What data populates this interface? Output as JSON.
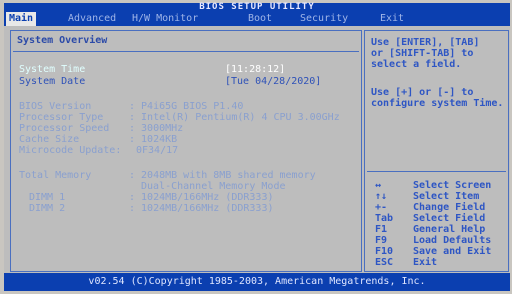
{
  "title": "BIOS SETUP UTILITY",
  "tabs": [
    "Main",
    "Advanced",
    "H/W Monitor",
    "Boot",
    "Security",
    "Exit"
  ],
  "overview": {
    "heading": "System Overview",
    "system_time_label": "System Time",
    "system_time_value": "[11:28:12]",
    "system_date_label": "System Date",
    "system_date_value": "[Tue 04/28/2020]",
    "bios_version_label": "BIOS Version",
    "bios_version_value": ": P4i65G BIOS P1.40",
    "processor_type_label": "Processor Type",
    "processor_type_value": ": Intel(R) Pentium(R) 4 CPU 3.00GHz",
    "processor_speed_label": "Processor Speed",
    "processor_speed_value": ": 3000MHz",
    "cache_size_label": "Cache Size",
    "cache_size_value": ": 1024KB",
    "microcode_label": "Microcode Update:",
    "microcode_value": "0F34/17",
    "total_memory_label": "Total Memory",
    "total_memory_value": ": 2048MB with 8MB shared memory",
    "memory_mode": "Dual-Channel Memory Mode",
    "dimm1_label": "DIMM 1",
    "dimm1_value": ": 1024MB/166MHz (DDR333)",
    "dimm2_label": "DIMM 2",
    "dimm2_value": ": 1024MB/166MHz (DDR333)"
  },
  "help": {
    "line1": "Use [ENTER], [TAB]",
    "line2": "or [SHIFT-TAB] to",
    "line3": "select a field.",
    "line4": "Use [+] or [-] to",
    "line5": "configure system Time."
  },
  "keys": [
    {
      "key": "↔",
      "action": "Select Screen"
    },
    {
      "key": "↑↓",
      "action": "Select Item"
    },
    {
      "key": "+-",
      "action": "Change Field"
    },
    {
      "key": "Tab",
      "action": "Select Field"
    },
    {
      "key": "F1",
      "action": "General Help"
    },
    {
      "key": "F9",
      "action": "Load Defaults"
    },
    {
      "key": "F10",
      "action": "Save and Exit"
    },
    {
      "key": "ESC",
      "action": "Exit"
    }
  ],
  "footer": "v02.54 (C)Copyright 1985-2003, American Megatrends, Inc."
}
